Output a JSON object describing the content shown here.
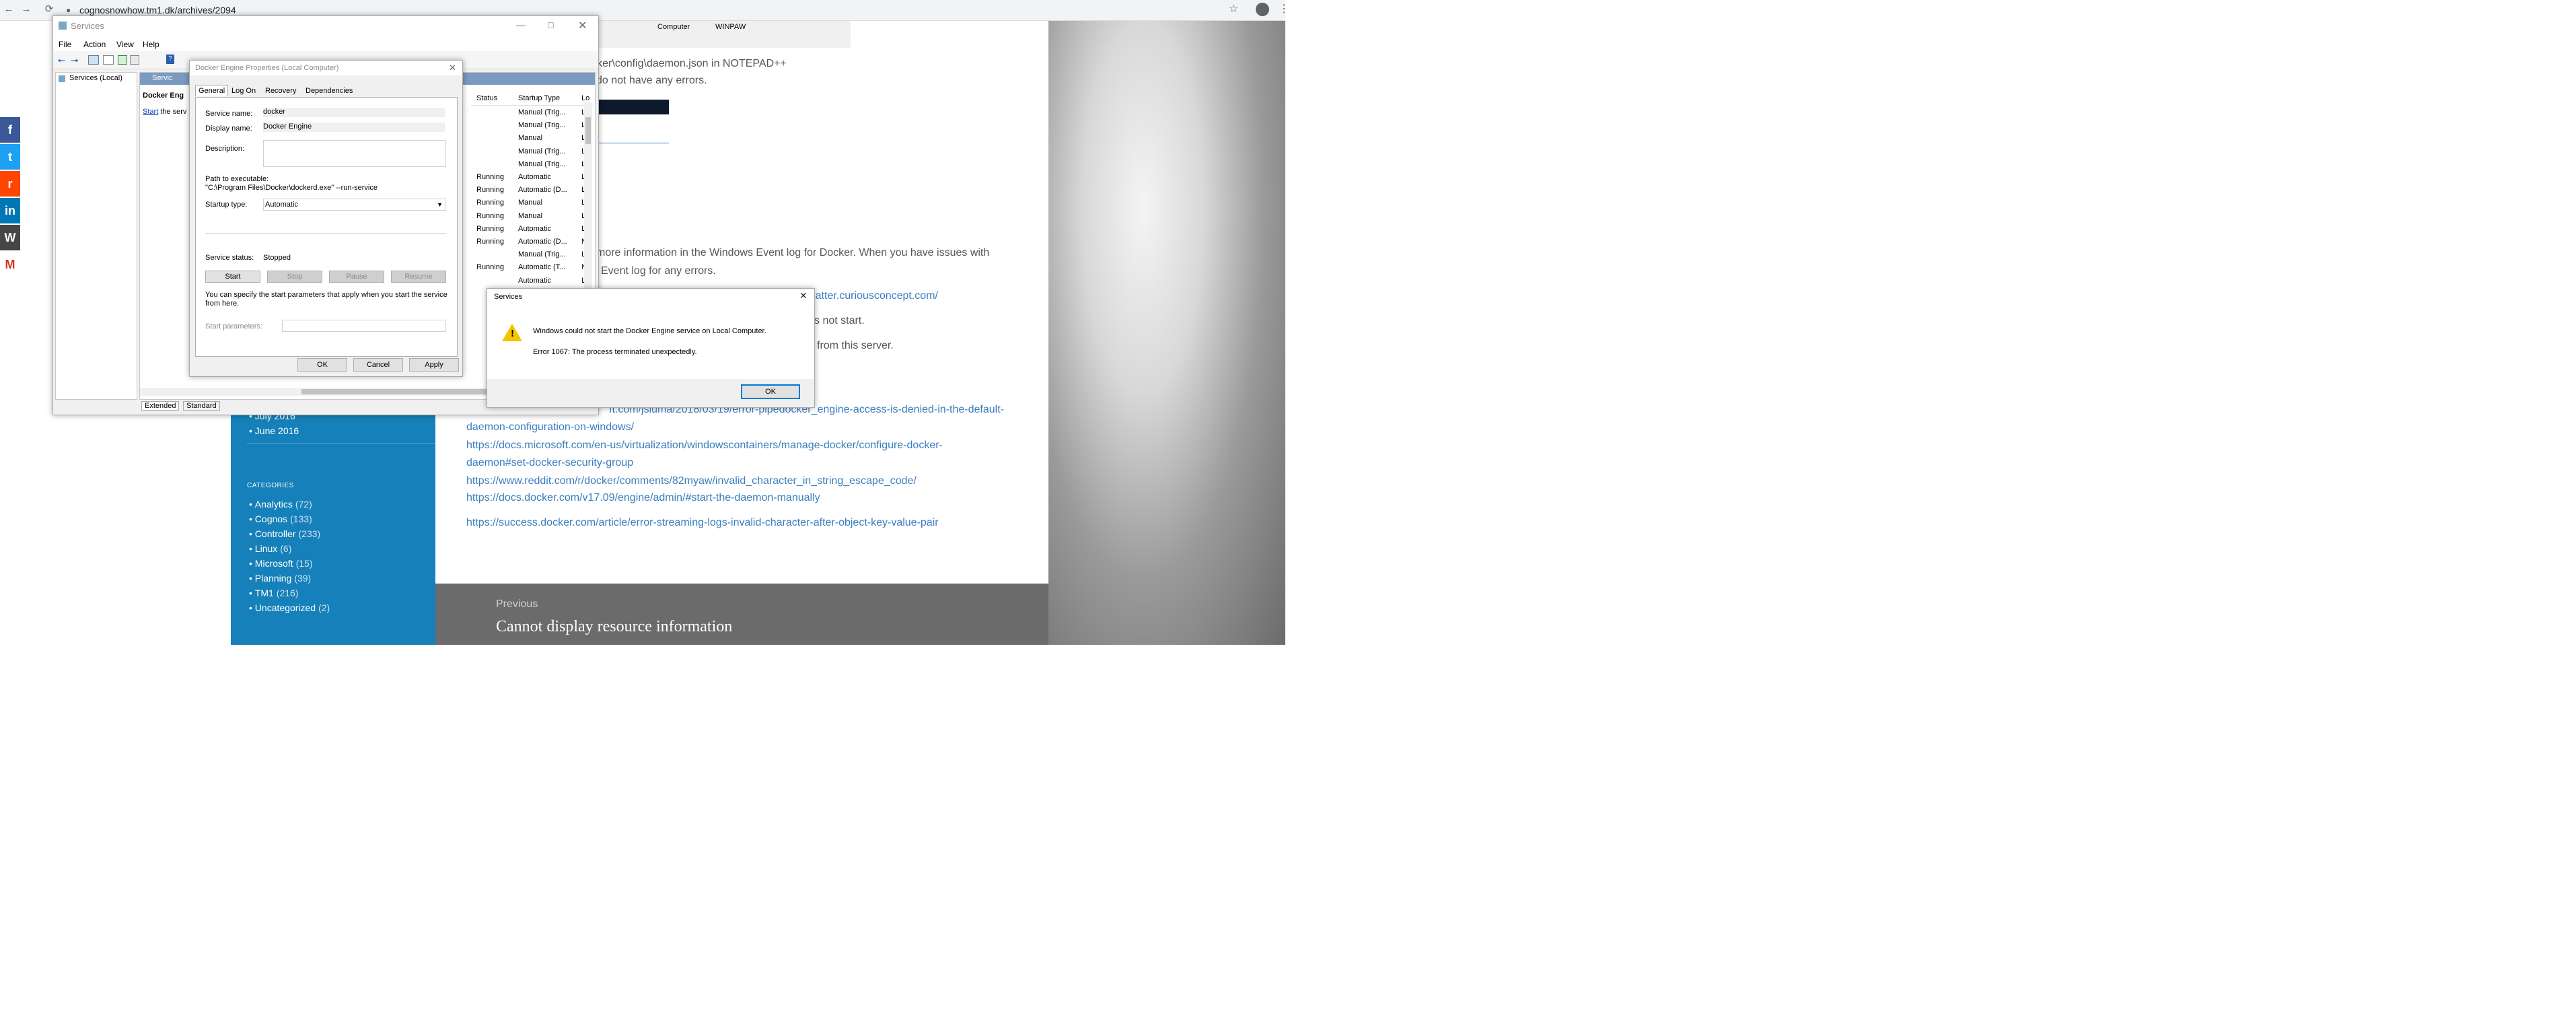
{
  "browser": {
    "url": "cognosnowhow.tm1.dk/archives/2094",
    "back_icon": "←",
    "forward_icon": "→",
    "reload_icon": "⟳"
  },
  "share_buttons": [
    "f",
    "t",
    "r",
    "in",
    "W",
    "M"
  ],
  "article": {
    "line1": "a\\docker\\config\\daemon.json in NOTEPAD++",
    "line2": "do not have any errors.",
    "line3": "more information in the Windows Event log for Docker. When you have issues with",
    "line4": "Event log for any errors.",
    "link_partial": "rmatter.curiousconcept.com/",
    "line5": "s not start.",
    "line6": "from this server.",
    "links": [
      "ft.com/jsiuma/2018/03/19/error-pipedocker_engine-access-is-denied-in-the-default-",
      "daemon-configuration-on-windows/",
      "https://docs.microsoft.com/en-us/virtualization/windowscontainers/manage-docker/configure-docker-",
      "daemon#set-docker-security-group",
      "https://www.reddit.com/r/docker/comments/82myaw/invalid_character_in_string_escape_code/",
      "https://docs.docker.com/v17.09/engine/admin/#start-the-daemon-manually",
      "https://success.docker.com/article/error-streaming-logs-invalid-character-after-object-key-value-pair"
    ],
    "previous_label": "Previous",
    "previous_title": "Cannot display resource information"
  },
  "sidebar": {
    "archives_tail": [
      "July 2016",
      "June 2016"
    ],
    "categories_heading": "CATEGORIES",
    "categories": [
      {
        "name": "Analytics",
        "count": "(72)"
      },
      {
        "name": "Cognos",
        "count": "(133)"
      },
      {
        "name": "Controller",
        "count": "(233)"
      },
      {
        "name": "Linux",
        "count": "(6)"
      },
      {
        "name": "Microsoft",
        "count": "(15)"
      },
      {
        "name": "Planning",
        "count": "(39)"
      },
      {
        "name": "TM1",
        "count": "(216)"
      },
      {
        "name": "Uncategorized",
        "count": "(2)"
      }
    ]
  },
  "bg_strip": {
    "computer_label": "Computer",
    "computer_value": "WINPAW"
  },
  "services_window": {
    "title": "Services",
    "menu": [
      "File",
      "Action",
      "View",
      "Help"
    ],
    "tree_item": "Services (Local)",
    "pane_tab": "Servic",
    "selected_name": "Docker Eng",
    "start_link": "Start",
    "start_text": "the serv",
    "bottom_tabs": [
      "Extended",
      "Standard"
    ],
    "grid_headers": [
      "Status",
      "Startup Type",
      "Lo"
    ],
    "rows": [
      {
        "status": "",
        "startup": "Manual (Trig...",
        "log": "Lo"
      },
      {
        "status": "",
        "startup": "Manual (Trig...",
        "log": "Lo"
      },
      {
        "status": "",
        "startup": "Manual",
        "log": "Lo"
      },
      {
        "status": "",
        "startup": "Manual (Trig...",
        "log": "Lo"
      },
      {
        "status": "",
        "startup": "Manual (Trig...",
        "log": "Lo"
      },
      {
        "status": "Running",
        "startup": "Automatic",
        "log": "Lo"
      },
      {
        "status": "Running",
        "startup": "Automatic (D...",
        "log": "Lo"
      },
      {
        "status": "Running",
        "startup": "Manual",
        "log": "Lo"
      },
      {
        "status": "Running",
        "startup": "Manual",
        "log": "Lo"
      },
      {
        "status": "Running",
        "startup": "Automatic",
        "log": "Lo"
      },
      {
        "status": "Running",
        "startup": "Automatic (D...",
        "log": "Ne"
      },
      {
        "status": "",
        "startup": "Manual (Trig...",
        "log": "Lo"
      },
      {
        "status": "Running",
        "startup": "Automatic (T...",
        "log": "Ne"
      },
      {
        "status": "",
        "startup": "Automatic",
        "log": "Lo"
      }
    ]
  },
  "props_dialog": {
    "title": "Docker Engine Properties (Local Computer)",
    "tabs": [
      "General",
      "Log On",
      "Recovery",
      "Dependencies"
    ],
    "service_name_label": "Service name:",
    "service_name": "docker",
    "display_name_label": "Display name:",
    "display_name": "Docker Engine",
    "description_label": "Description:",
    "path_label": "Path to executable:",
    "path": "\"C:\\Program Files\\Docker\\dockerd.exe\" --run-service",
    "startup_type_label": "Startup type:",
    "startup_type": "Automatic",
    "status_label": "Service status:",
    "status": "Stopped",
    "btn_start": "Start",
    "btn_stop": "Stop",
    "btn_pause": "Pause",
    "btn_resume": "Resume",
    "params_note": "You can specify the start parameters that apply when you start the service from here.",
    "params_label": "Start parameters:",
    "ok": "OK",
    "cancel": "Cancel",
    "apply": "Apply"
  },
  "error_dialog": {
    "title": "Services",
    "message": "Windows could not start the Docker Engine service on Local Computer.",
    "error": "Error 1067: The process terminated unexpectedly.",
    "ok": "OK"
  }
}
